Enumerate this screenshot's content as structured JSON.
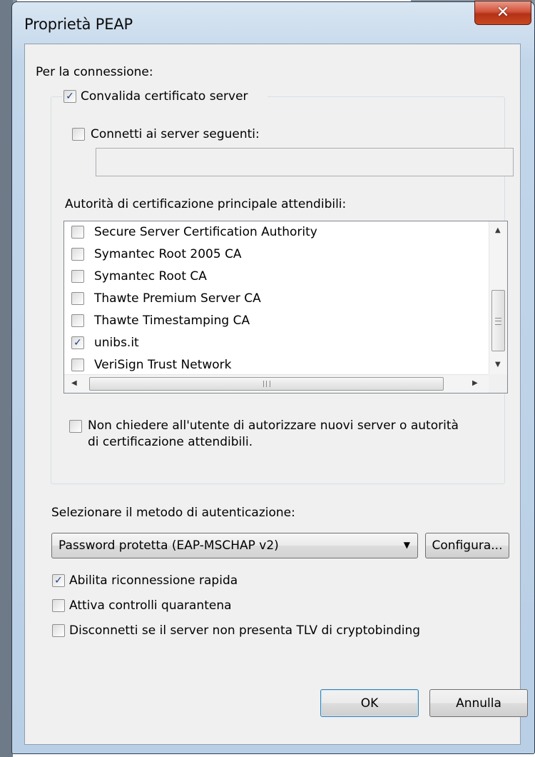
{
  "window": {
    "title": "Proprietà PEAP"
  },
  "connection": {
    "heading": "Per la connessione:",
    "validate_server_cert": {
      "label": "Convalida certificato server",
      "checked": true
    },
    "connect_to_servers": {
      "label": "Connetti ai server seguenti:",
      "checked": false,
      "value": ""
    },
    "trusted_root_heading": "Autorità di certificazione principale attendibili:",
    "cert_authorities": [
      {
        "name": "Secure Server Certification Authority",
        "checked": false
      },
      {
        "name": "Symantec Root 2005 CA",
        "checked": false
      },
      {
        "name": "Symantec Root CA",
        "checked": false
      },
      {
        "name": "Thawte Premium Server CA",
        "checked": false
      },
      {
        "name": "Thawte Timestamping CA",
        "checked": false
      },
      {
        "name": "unibs.it",
        "checked": true
      },
      {
        "name": "VeriSign Trust Network",
        "checked": false
      }
    ],
    "no_prompt": {
      "line1": "Non chiedere all'utente di autorizzare nuovi server o autorità",
      "line2": "di certificazione attendibili.",
      "checked": false
    }
  },
  "auth": {
    "heading": "Selezionare il metodo di autenticazione:",
    "method": "Password protetta (EAP-MSCHAP v2)",
    "configure_label": "Configura...",
    "options": [
      {
        "label": "Abilita riconnessione rapida",
        "checked": true
      },
      {
        "label": "Attiva controlli quarantena",
        "checked": false
      },
      {
        "label": "Disconnetti se il server non presenta TLV di cryptobinding",
        "checked": false
      }
    ]
  },
  "buttons": {
    "ok": "OK",
    "cancel": "Annulla"
  },
  "icons": {
    "close": "close-icon",
    "check": "checkmark-icon"
  }
}
